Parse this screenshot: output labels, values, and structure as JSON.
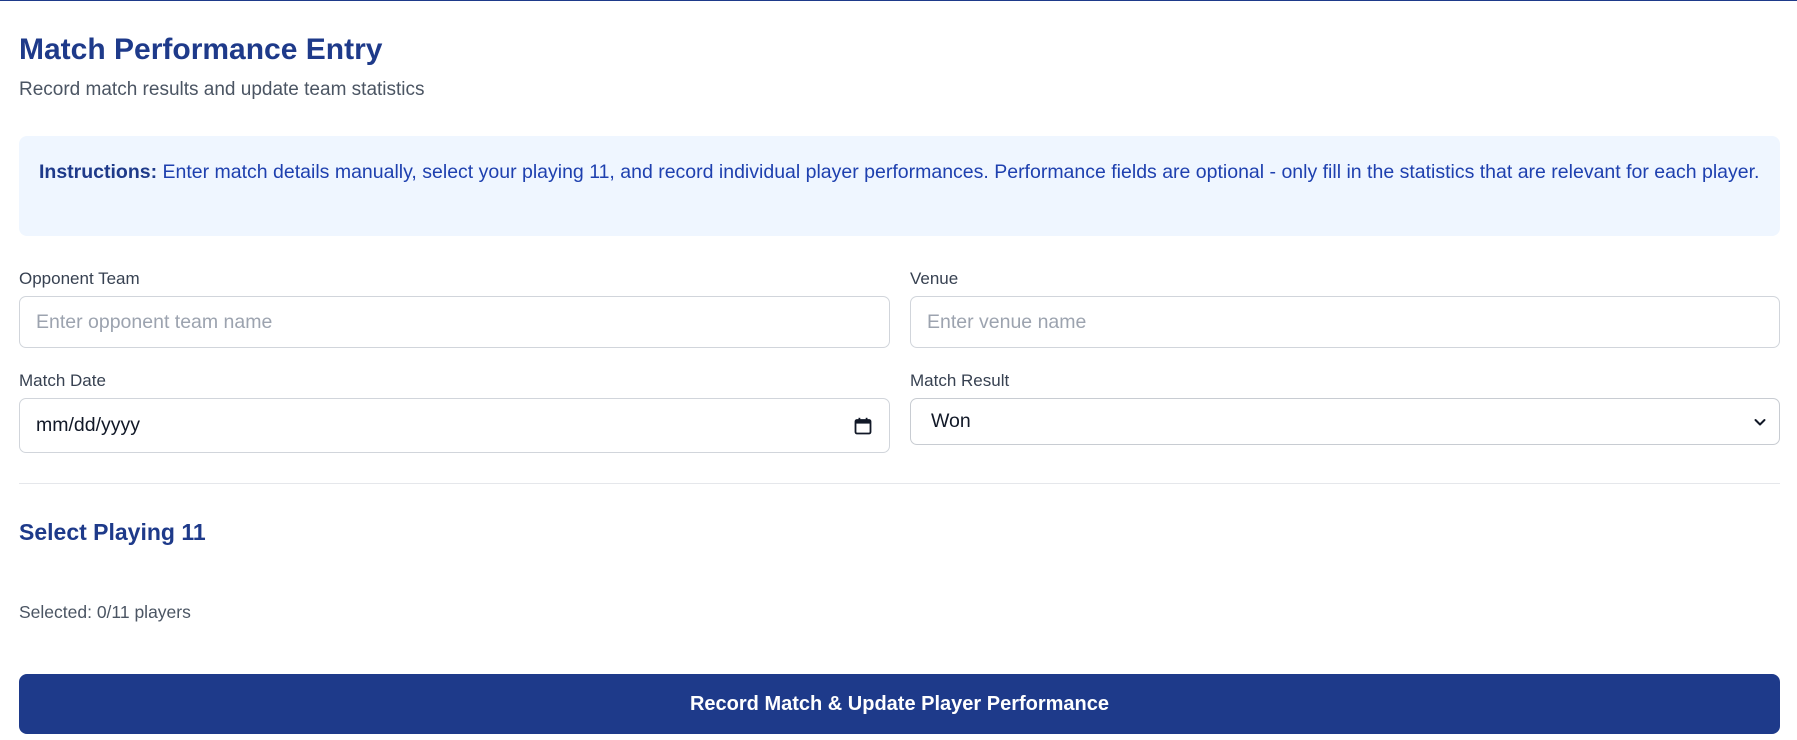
{
  "header": {
    "title": "Match Performance Entry",
    "subtitle": "Record match results and update team statistics"
  },
  "instructions": {
    "label": "Instructions:",
    "text": "Enter match details manually, select your playing 11, and record individual player performances. Performance fields are optional - only fill in the statistics that are relevant for each player."
  },
  "form": {
    "opponent_team": {
      "label": "Opponent Team",
      "value": "",
      "placeholder": "Enter opponent team name"
    },
    "venue": {
      "label": "Venue",
      "value": "",
      "placeholder": "Enter venue name"
    },
    "match_date": {
      "label": "Match Date",
      "value": "",
      "display": "mm/dd/yyyy",
      "icon": "calendar-icon"
    },
    "match_result": {
      "label": "Match Result",
      "selected": "Won",
      "icon": "chevron-down-icon"
    }
  },
  "playing11": {
    "title": "Select Playing 11",
    "selected_text": "Selected: 0/11 players"
  },
  "submit": {
    "label": "Record Match & Update Player Performance"
  },
  "colors": {
    "primary": "#1e3a8a",
    "instructions_bg": "#eff6ff",
    "instructions_text": "#1e40af"
  }
}
